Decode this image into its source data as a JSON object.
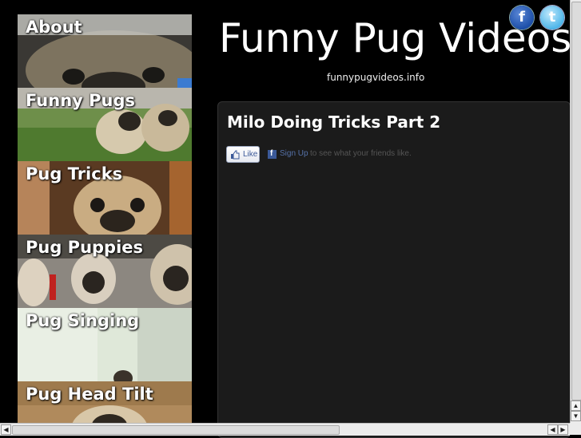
{
  "site": {
    "title": "Funny Pug Videos",
    "url": "funnypugvideos.info"
  },
  "social": {
    "facebook_icon": "facebook-icon",
    "twitter_icon": "twitter-icon",
    "facebook_glyph": "f",
    "twitter_glyph": "t"
  },
  "sidebar": {
    "items": [
      {
        "label": "About"
      },
      {
        "label": "Funny Pugs"
      },
      {
        "label": "Pug Tricks"
      },
      {
        "label": "Pug Puppies"
      },
      {
        "label": "Pug Singing"
      },
      {
        "label": "Pug Head Tilt"
      }
    ]
  },
  "post": {
    "title": "Milo Doing Tricks Part 2",
    "like_label": "Like",
    "signup_label": "Sign Up",
    "friends_text": "to see what your friends like."
  },
  "colors": {
    "background": "#000000",
    "panel": "#1b1b1b",
    "facebook": "#3b5998"
  }
}
